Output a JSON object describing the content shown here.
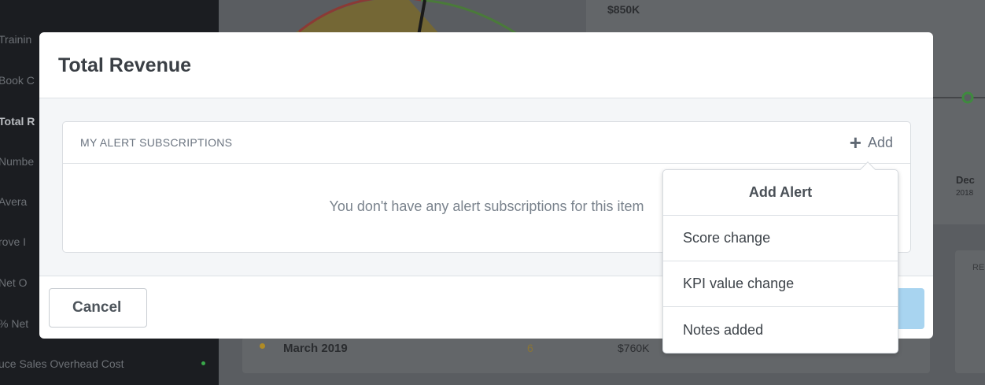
{
  "background": {
    "sidebar_items": [
      {
        "label": "Trainin",
        "active": false
      },
      {
        "label": "Book C",
        "active": false
      },
      {
        "label": "Total R",
        "active": true
      },
      {
        "label": "Numbe",
        "active": false
      },
      {
        "label": "Avera",
        "active": false
      },
      {
        "label": "rove I",
        "active": false
      },
      {
        "label": "Net O",
        "active": false
      },
      {
        "label": "% Net",
        "active": false
      },
      {
        "label": "uce Sales Overhead Cost",
        "active": false
      }
    ],
    "top_value": "$850K",
    "date_month": "Dec",
    "date_year": "2018",
    "right_card_label": "RE",
    "row": {
      "label": "March 2019",
      "count": "6",
      "amount": "$760K"
    }
  },
  "modal": {
    "title": "Total Revenue",
    "subscriptions": {
      "heading": "MY ALERT SUBSCRIPTIONS",
      "add_label": "Add",
      "empty_message": "You don't have any alert subscriptions for this item"
    },
    "cancel_label": "Cancel"
  },
  "dropdown": {
    "title": "Add Alert",
    "items": [
      "Score change",
      "KPI value change",
      "Notes added"
    ]
  },
  "colors": {
    "accent_blue": "#a8d4f0",
    "status_green": "#39a84a",
    "overlay": "#55585d"
  }
}
